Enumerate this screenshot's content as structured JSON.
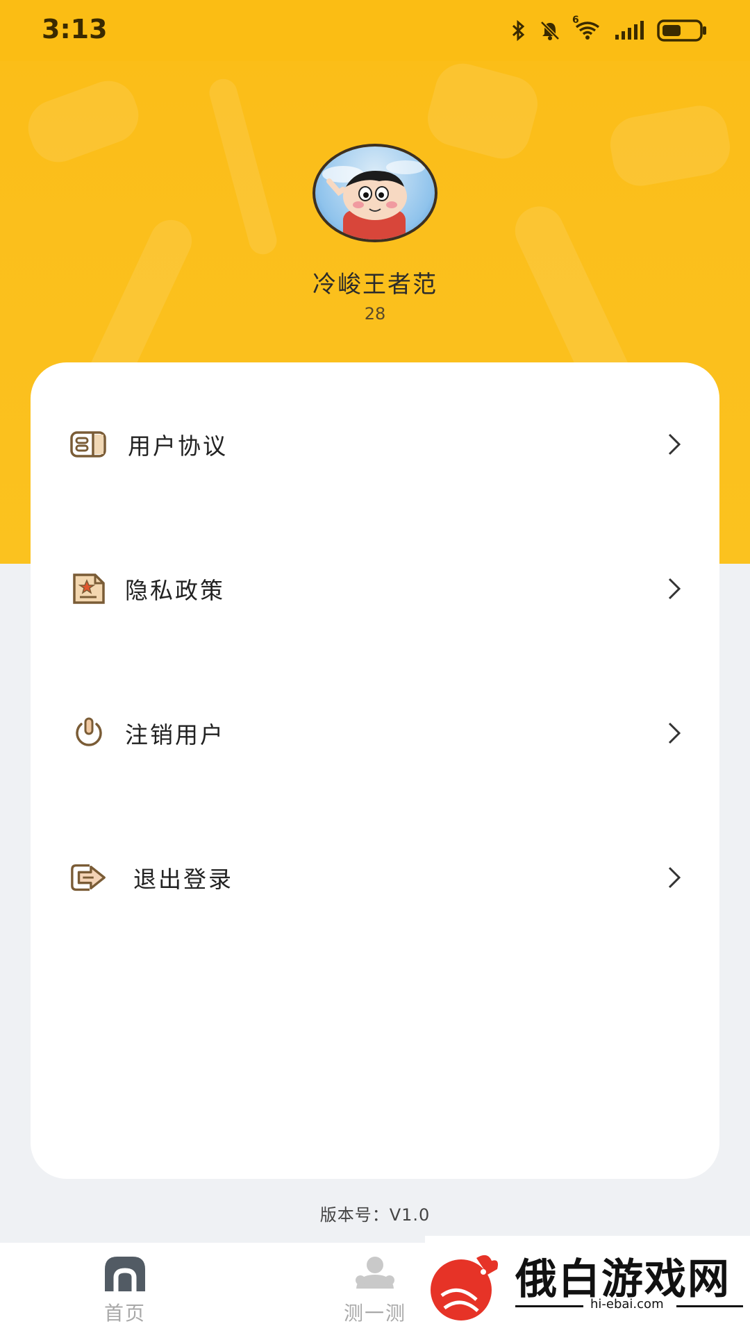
{
  "status_bar": {
    "time": "3:13",
    "icons": [
      "bluetooth-icon",
      "mute-bell-icon",
      "wifi-icon",
      "signal-icon",
      "battery-icon"
    ],
    "network_badge": "6"
  },
  "profile": {
    "name": "冷峻王者范",
    "age": "28"
  },
  "menu": {
    "items": [
      {
        "label": "用户协议",
        "icon": "agreement-icon"
      },
      {
        "label": "隐私政策",
        "icon": "privacy-doc-icon"
      },
      {
        "label": "注销用户",
        "icon": "power-icon"
      },
      {
        "label": "退出登录",
        "icon": "logout-icon"
      }
    ]
  },
  "footer": {
    "version": "版本号：V1.0"
  },
  "bottom_nav": {
    "items": [
      {
        "label": "首页",
        "icon": "home-icon"
      },
      {
        "label": "测一测",
        "icon": "test-icon"
      }
    ]
  },
  "watermark": {
    "text": "俄白游戏网",
    "sub": "hi-ebai.com"
  },
  "colors": {
    "header": "#fbbd17",
    "icon_brown": "#7a5c36",
    "icon_accent": "#e0562e",
    "background": "#eff1f4"
  }
}
